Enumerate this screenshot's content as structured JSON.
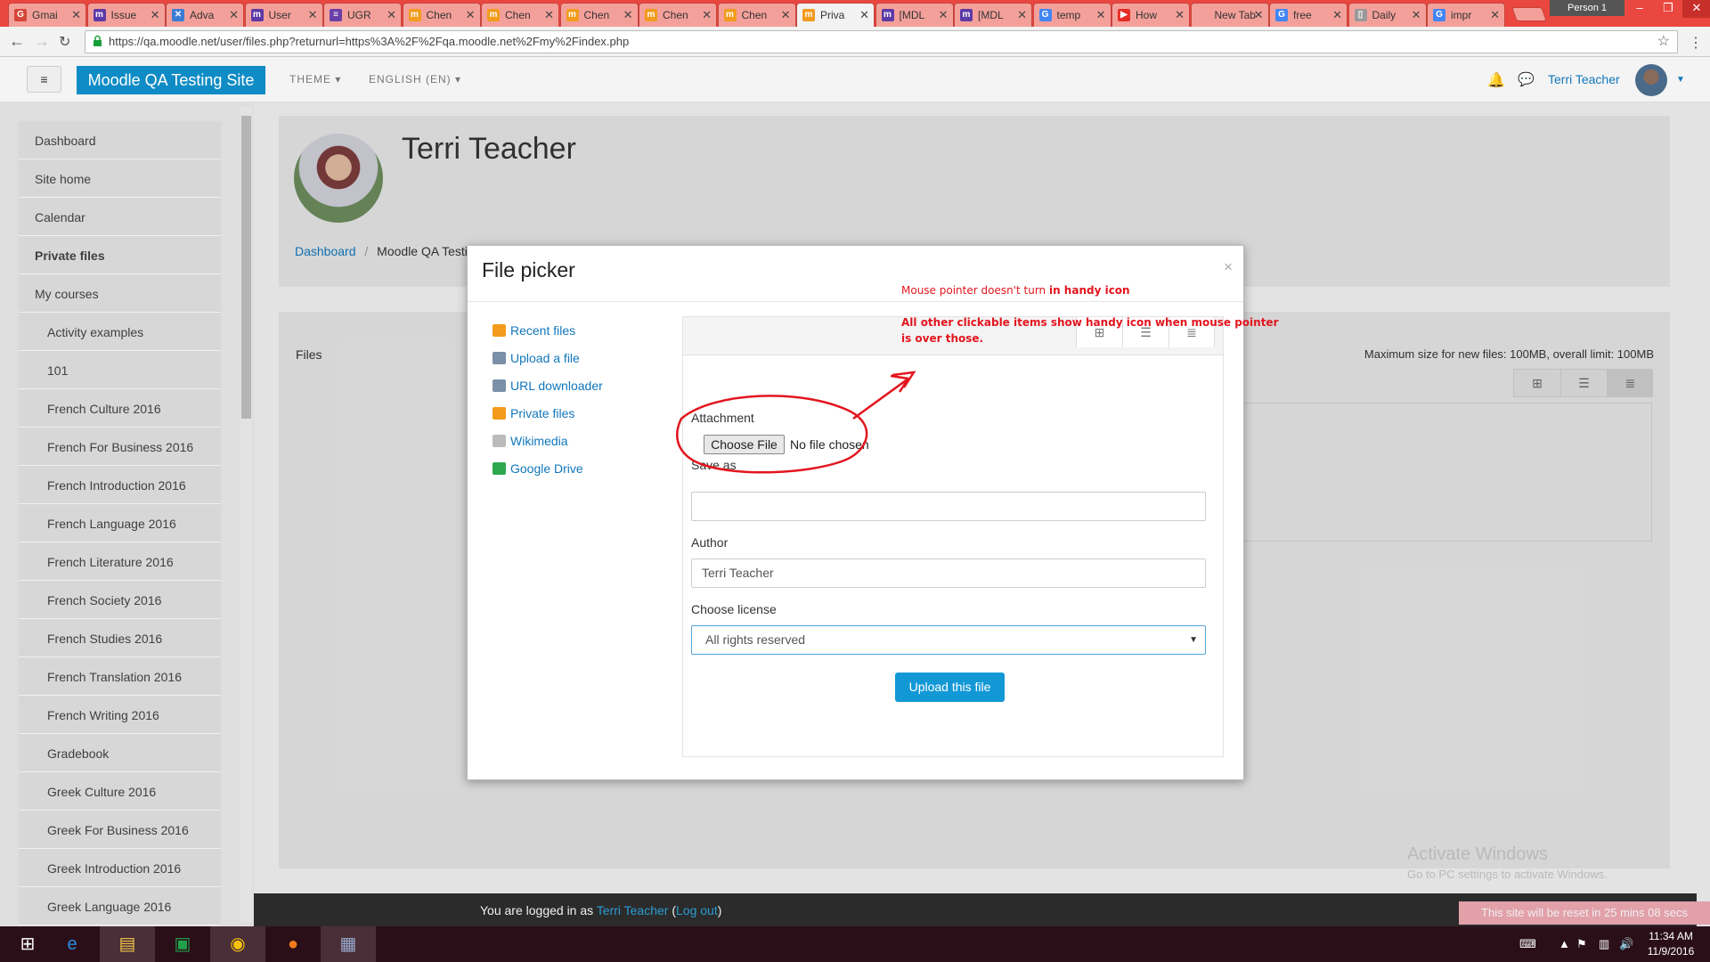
{
  "browser": {
    "tabs": [
      {
        "label": "Gmai",
        "fav_color": "#d44638",
        "fav_glyph": "G"
      },
      {
        "label": "Issue",
        "fav_color": "#5e3aa6",
        "fav_glyph": "m"
      },
      {
        "label": "Adva",
        "fav_color": "#3a7bd5",
        "fav_glyph": "✕"
      },
      {
        "label": "User",
        "fav_color": "#5e3aa6",
        "fav_glyph": "m"
      },
      {
        "label": "UGR",
        "fav_color": "#6a3fa8",
        "fav_glyph": "≡"
      },
      {
        "label": "Chen",
        "fav_color": "#f29b1d",
        "fav_glyph": "m"
      },
      {
        "label": "Chen",
        "fav_color": "#f29b1d",
        "fav_glyph": "m"
      },
      {
        "label": "Chen",
        "fav_color": "#f29b1d",
        "fav_glyph": "m"
      },
      {
        "label": "Chen",
        "fav_color": "#f29b1d",
        "fav_glyph": "m"
      },
      {
        "label": "Chen",
        "fav_color": "#f29b1d",
        "fav_glyph": "m"
      },
      {
        "label": "Priva",
        "fav_color": "#f29b1d",
        "fav_glyph": "m",
        "active": true
      },
      {
        "label": "[MDL",
        "fav_color": "#5e3aa6",
        "fav_glyph": "m"
      },
      {
        "label": "[MDL",
        "fav_color": "#5e3aa6",
        "fav_glyph": "m"
      },
      {
        "label": "temp",
        "fav_color": "#4285f4",
        "fav_glyph": "G"
      },
      {
        "label": "How",
        "fav_color": "#e52d27",
        "fav_glyph": "▶"
      },
      {
        "label": "New Tab",
        "fav_color": "",
        "fav_glyph": ""
      },
      {
        "label": "free",
        "fav_color": "#4285f4",
        "fav_glyph": "G"
      },
      {
        "label": "Daily",
        "fav_color": "#999999",
        "fav_glyph": "▯"
      },
      {
        "label": "impr",
        "fav_color": "#4285f4",
        "fav_glyph": "G"
      }
    ],
    "person": "Person 1",
    "url": "https://qa.moodle.net/user/files.php?returnurl=https%3A%2F%2Fqa.moodle.net%2Fmy%2Findex.php"
  },
  "navbar": {
    "brand": "Moodle QA Testing Site",
    "theme": "THEME",
    "language": "ENGLISH (EN)",
    "user_name": "Terri Teacher"
  },
  "drawer": {
    "items": [
      {
        "label": "Dashboard",
        "sub": false,
        "bold": false
      },
      {
        "label": "Site home",
        "sub": false,
        "bold": false
      },
      {
        "label": "Calendar",
        "sub": false,
        "bold": false
      },
      {
        "label": "Private files",
        "sub": false,
        "bold": true
      },
      {
        "label": "My courses",
        "sub": false,
        "bold": false
      },
      {
        "label": "Activity examples",
        "sub": true,
        "bold": false
      },
      {
        "label": "101",
        "sub": true,
        "bold": false
      },
      {
        "label": "French Culture 2016",
        "sub": true,
        "bold": false
      },
      {
        "label": "French For Business 2016",
        "sub": true,
        "bold": false
      },
      {
        "label": "French Introduction 2016",
        "sub": true,
        "bold": false
      },
      {
        "label": "French Language 2016",
        "sub": true,
        "bold": false
      },
      {
        "label": "French Literature 2016",
        "sub": true,
        "bold": false
      },
      {
        "label": "French Society 2016",
        "sub": true,
        "bold": false
      },
      {
        "label": "French Studies 2016",
        "sub": true,
        "bold": false
      },
      {
        "label": "French Translation 2016",
        "sub": true,
        "bold": false
      },
      {
        "label": "French Writing 2016",
        "sub": true,
        "bold": false
      },
      {
        "label": "Gradebook",
        "sub": true,
        "bold": false
      },
      {
        "label": "Greek Culture 2016",
        "sub": true,
        "bold": false
      },
      {
        "label": "Greek For Business 2016",
        "sub": true,
        "bold": false
      },
      {
        "label": "Greek Introduction 2016",
        "sub": true,
        "bold": false
      },
      {
        "label": "Greek Language 2016",
        "sub": true,
        "bold": false
      }
    ]
  },
  "page": {
    "title": "Terri Teacher",
    "breadcrumb_home": "Dashboard",
    "breadcrumb_sep": "/",
    "breadcrumb_current": "Moodle QA Testi",
    "files_label": "Files",
    "max_size": "Maximum size for new files: 100MB, overall limit: 100MB"
  },
  "dialog": {
    "title": "File picker",
    "close": "×",
    "repositories": [
      {
        "label": "Recent files",
        "icon": "moodle-icon",
        "color": "#f29b1d"
      },
      {
        "label": "Upload a file",
        "icon": "upload-icon",
        "color": "#7a8fa8"
      },
      {
        "label": "URL downloader",
        "icon": "url-icon",
        "color": "#7a8fa8"
      },
      {
        "label": "Private files",
        "icon": "moodle-icon",
        "color": "#f29b1d"
      },
      {
        "label": "Wikimedia",
        "icon": "wikimedia-icon",
        "color": "#bbbbbb"
      },
      {
        "label": "Google Drive",
        "icon": "drive-icon",
        "color": "#2ea84f"
      }
    ],
    "attachment_label": "Attachment",
    "choose_file": "Choose File",
    "no_file": "No file chosen",
    "save_as_label": "Save as",
    "save_as_value": "",
    "author_label": "Author",
    "author_value": "Terri Teacher",
    "license_label": "Choose license",
    "license_value": "All rights reserved",
    "upload_button": "Upload this file"
  },
  "annotations": {
    "line1_a": "Mouse pointer doesn't turn ",
    "line1_b": "in handy icon",
    "line2": "All other clickable items show handy icon when mouse pointer",
    "line3": "is over those."
  },
  "footer": {
    "logged_prefix": "You are logged in as ",
    "user": "Terri Teacher",
    "logout_open": " (",
    "logout": "Log out",
    "logout_close": ")",
    "reset_notice": "This site will be reset in 25 mins 08 secs"
  },
  "windows": {
    "activate_title": "Activate Windows",
    "activate_sub": "Go to PC settings to activate Windows.",
    "time": "11:34 AM",
    "date": "11/9/2016"
  }
}
